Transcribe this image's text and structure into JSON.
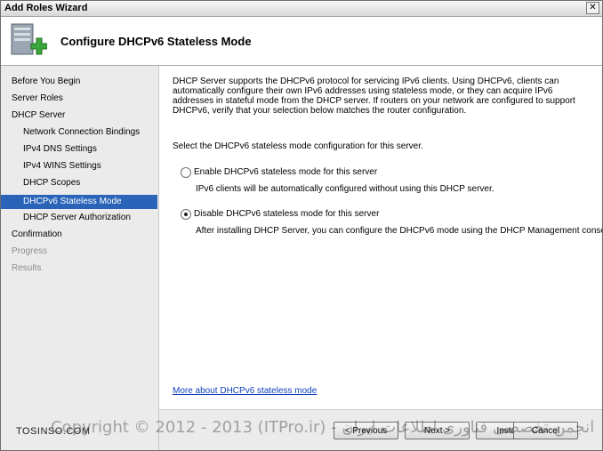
{
  "window": {
    "title": "Add Roles Wizard",
    "close_glyph": "✕"
  },
  "header": {
    "heading": "Configure DHCPv6 Stateless Mode"
  },
  "nav": {
    "items": [
      {
        "label": "Before You Begin",
        "state": "normal",
        "level": "top"
      },
      {
        "label": "Server Roles",
        "state": "normal",
        "level": "top"
      },
      {
        "label": "DHCP Server",
        "state": "normal",
        "level": "top"
      },
      {
        "label": "Network Connection Bindings",
        "state": "normal",
        "level": "sub"
      },
      {
        "label": "IPv4 DNS Settings",
        "state": "normal",
        "level": "sub"
      },
      {
        "label": "IPv4 WINS Settings",
        "state": "normal",
        "level": "sub"
      },
      {
        "label": "DHCP Scopes",
        "state": "normal",
        "level": "sub"
      },
      {
        "label": "DHCPv6 Stateless Mode",
        "state": "active",
        "level": "sub"
      },
      {
        "label": "DHCP Server Authorization",
        "state": "normal",
        "level": "sub"
      },
      {
        "label": "Confirmation",
        "state": "normal",
        "level": "top"
      },
      {
        "label": "Progress",
        "state": "disabled",
        "level": "top"
      },
      {
        "label": "Results",
        "state": "disabled",
        "level": "top"
      }
    ]
  },
  "content": {
    "description": "DHCP Server supports the DHCPv6 protocol for servicing IPv6 clients. Using DHCPv6, clients can automatically configure their own IPv6 addresses using stateless mode, or they can acquire IPv6 addresses in stateful mode from the DHCP server. If routers on your network are configured to support DHCPv6, verify that your selection below matches the router configuration.",
    "prompt": "Select the DHCPv6 stateless mode configuration for this server.",
    "options": [
      {
        "label": "Enable DHCPv6 stateless mode for this server",
        "description": "IPv6 clients will be automatically configured without using this DHCP server.",
        "selected": false
      },
      {
        "label": "Disable DHCPv6 stateless mode for this server",
        "description": "After installing DHCP Server, you can configure the DHCPv6 mode using the DHCP Management console.",
        "selected": true
      }
    ],
    "more_link": "More about DHCPv6 stateless mode"
  },
  "footer": {
    "previous_label": "< Previous",
    "next_label": "Next >",
    "install_label": "Install",
    "cancel_label": "Cancel"
  },
  "overlay": {
    "watermark": "Copyright © 2012 - 2013 (ITPro.ir) - انجمن تخصصی فناوری اطلاعات ایران",
    "logo": "TOSINSO.COM"
  },
  "colors": {
    "accent": "#2a64b8",
    "link": "#0b3ebd",
    "icon_green": "#3ba63b"
  }
}
